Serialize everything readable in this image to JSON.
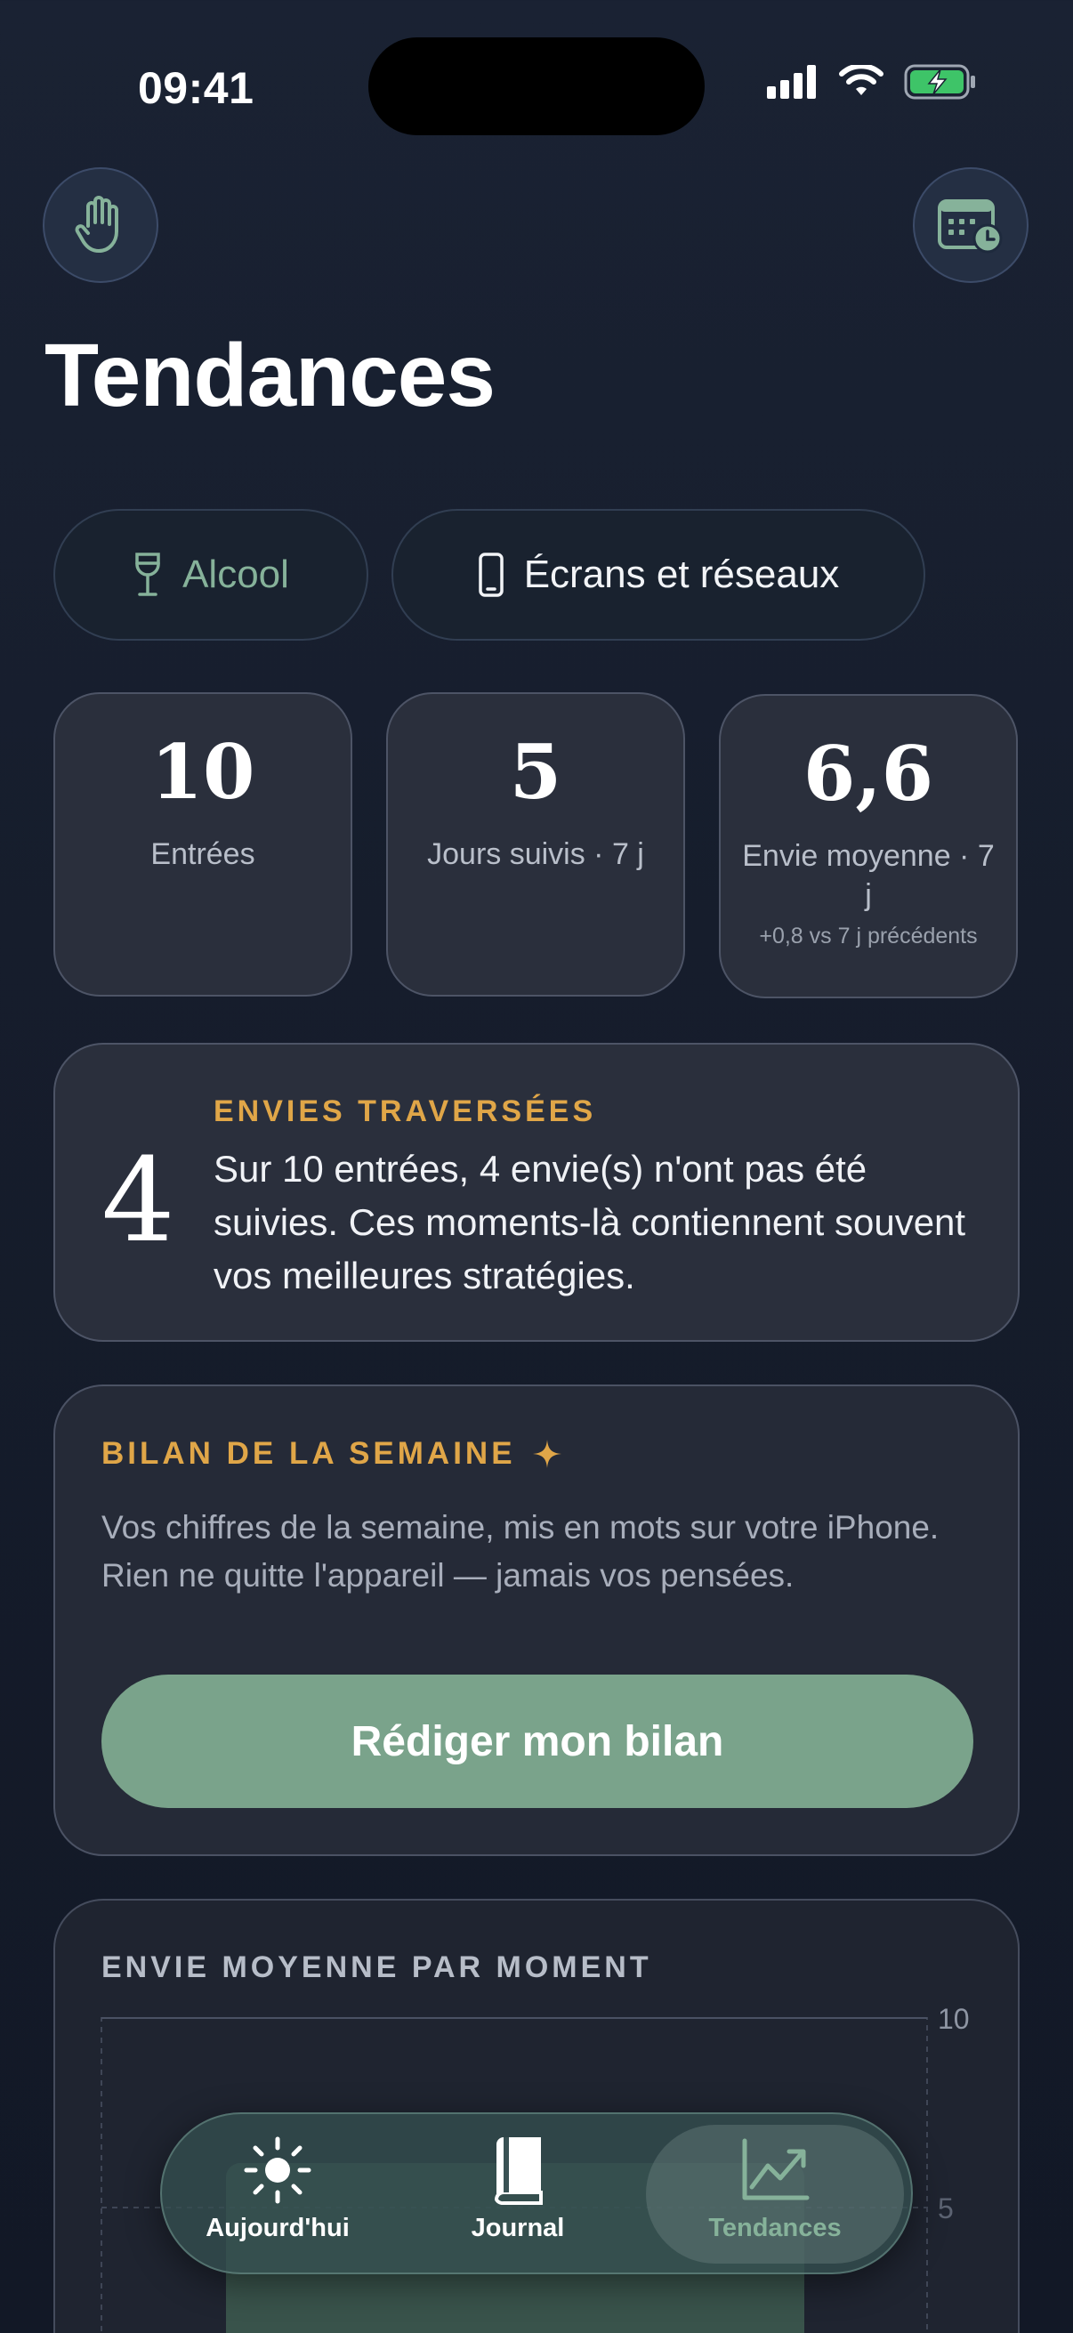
{
  "status": {
    "time": "09:41"
  },
  "header": {
    "title": "Tendances",
    "left_icon": "hand-icon",
    "right_icon": "calendar-clock-icon"
  },
  "segments": [
    {
      "label": "Alcool",
      "icon": "wine-glass-icon",
      "selected": true
    },
    {
      "label": "Écrans et réseaux",
      "icon": "phone-icon",
      "selected": false
    }
  ],
  "stats": [
    {
      "value": "10",
      "label": "Entrées"
    },
    {
      "value": "5",
      "label": "Jours suivis · 7 j"
    },
    {
      "value": "6,6",
      "label": "Envie moyenne · 7 j",
      "sub": "+0,8 vs 7 j précédents"
    }
  ],
  "envies": {
    "count": "4",
    "kicker": "ENVIES TRAVERSÉES",
    "text": "Sur 10 entrées, 4 envie(s) n'ont pas été suivies. Ces moments-là contiennent souvent vos meilleures stratégies."
  },
  "bilan": {
    "kicker": "BILAN DE LA SEMAINE",
    "text": "Vos chiffres de la semaine, mis en mots sur votre iPhone. Rien ne quitte l'appareil — jamais vos pensées.",
    "button": "Rédiger mon bilan"
  },
  "chart": {
    "kicker": "ENVIE MOYENNE PAR MOMENT"
  },
  "chart_data": {
    "type": "bar",
    "title": "ENVIE MOYENNE PAR MOMENT",
    "ylim": [
      0,
      10
    ],
    "yticks": [
      "10",
      "5"
    ],
    "grid": true
  },
  "tabs": [
    {
      "label": "Aujourd'hui",
      "icon": "sun-icon"
    },
    {
      "label": "Journal",
      "icon": "book-icon"
    },
    {
      "label": "Tendances",
      "icon": "chart-line-icon",
      "selected": true
    }
  ],
  "colors": {
    "accent": "#86b29a",
    "kicker": "#e0a648",
    "button": "#7aa38b"
  }
}
